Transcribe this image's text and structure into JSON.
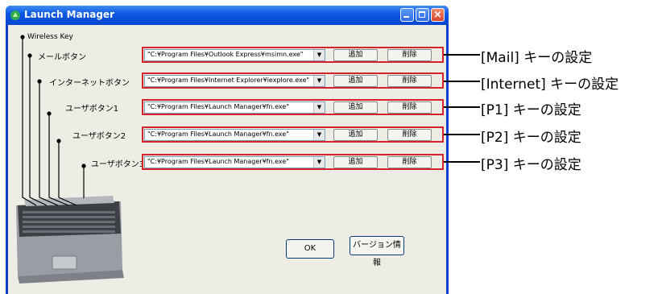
{
  "window": {
    "title": "Launch Manager"
  },
  "tree": {
    "root": "Wireless Key",
    "items": [
      {
        "label": "メールボタン",
        "path": "\"C:¥Program Files¥Outlook Express¥msimn.exe\"",
        "callout": "[Mail] キーの設定"
      },
      {
        "label": "インターネットボタン",
        "path": "\"C:¥Program Files¥Internet Explorer¥iexplore.exe\"",
        "callout": "[Internet] キーの設定"
      },
      {
        "label": "ユーザボタン1",
        "path": "\"C:¥Program Files¥Launch Manager¥fn.exe\"",
        "callout": "[P1] キーの設定"
      },
      {
        "label": "ユーザボタン2",
        "path": "\"C:¥Program Files¥Launch Manager¥fn.exe\"",
        "callout": "[P2] キーの設定"
      },
      {
        "label": "ユーザボタン3",
        "path": "\"C:¥Program Files¥Launch Manager¥fn.exe\"",
        "callout": "[P3] キーの設定"
      }
    ]
  },
  "buttons": {
    "add": "追加",
    "delete": "削除",
    "ok": "OK",
    "version": "バージョン情報"
  },
  "icons": {
    "dropdown": "chevron-down-icon",
    "app": "app-icon",
    "minimize": "minimize-icon",
    "maximize": "maximize-icon",
    "close": "close-icon",
    "laptop": "laptop-image"
  },
  "colors": {
    "highlight": "#d4232b",
    "titlebar": "#0a55e3",
    "dialog": "#eeede5"
  }
}
